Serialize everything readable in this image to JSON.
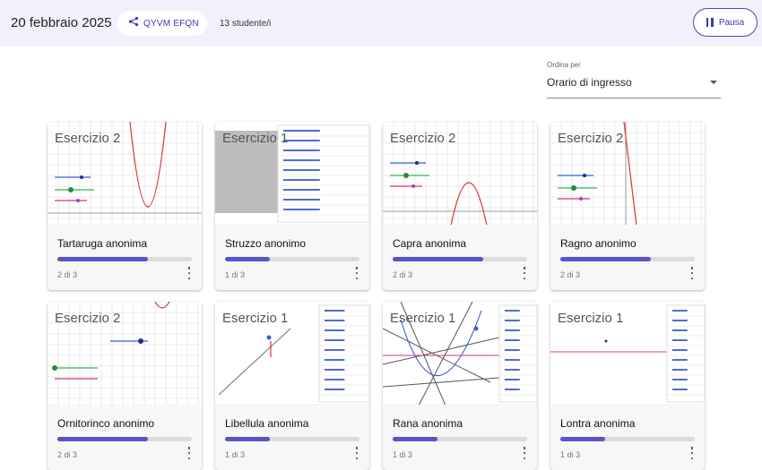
{
  "header": {
    "date": "20 febbraio 2025",
    "code": "QYVM EFQN",
    "students": "13 studente/i",
    "pause_label": "Pausa"
  },
  "sort": {
    "caption": "Ordina per",
    "value": "Orario di ingresso"
  },
  "colors": {
    "accent": "#5b53c8",
    "header_bg": "#f2f0fb",
    "track": "#dcdcdc"
  },
  "cards": [
    {
      "exercise": "Esercizio 2",
      "name": "Tartaruga anonima",
      "progress_text": "2 di 3",
      "progress": 0.667,
      "thumb": "graph-parabola"
    },
    {
      "exercise": "Esercizio 1",
      "name": "Struzzo anonimo",
      "progress_text": "1 di 3",
      "progress": 0.333,
      "thumb": "table-gray"
    },
    {
      "exercise": "Esercizio 2",
      "name": "Capra anonima",
      "progress_text": "2 di 3",
      "progress": 0.667,
      "thumb": "graph-parabola-down"
    },
    {
      "exercise": "Esercizio 2",
      "name": "Ragno anonimo",
      "progress_text": "2 di 3",
      "progress": 0.667,
      "thumb": "graph-line"
    },
    {
      "exercise": "Esercizio 2",
      "name": "Ornitorinco anonimo",
      "progress_text": "2 di 3",
      "progress": 0.667,
      "thumb": "graph-sliders"
    },
    {
      "exercise": "Esercizio 1",
      "name": "Libellula anonima",
      "progress_text": "1 di 3",
      "progress": 0.333,
      "thumb": "segment-table"
    },
    {
      "exercise": "Esercizio 1",
      "name": "Rana anonima",
      "progress_text": "1 di 3",
      "progress": 0.333,
      "thumb": "many-lines"
    },
    {
      "exercise": "Esercizio 1",
      "name": "Lontra anonima",
      "progress_text": "1 di 3",
      "progress": 0.333,
      "thumb": "hline-table"
    }
  ]
}
